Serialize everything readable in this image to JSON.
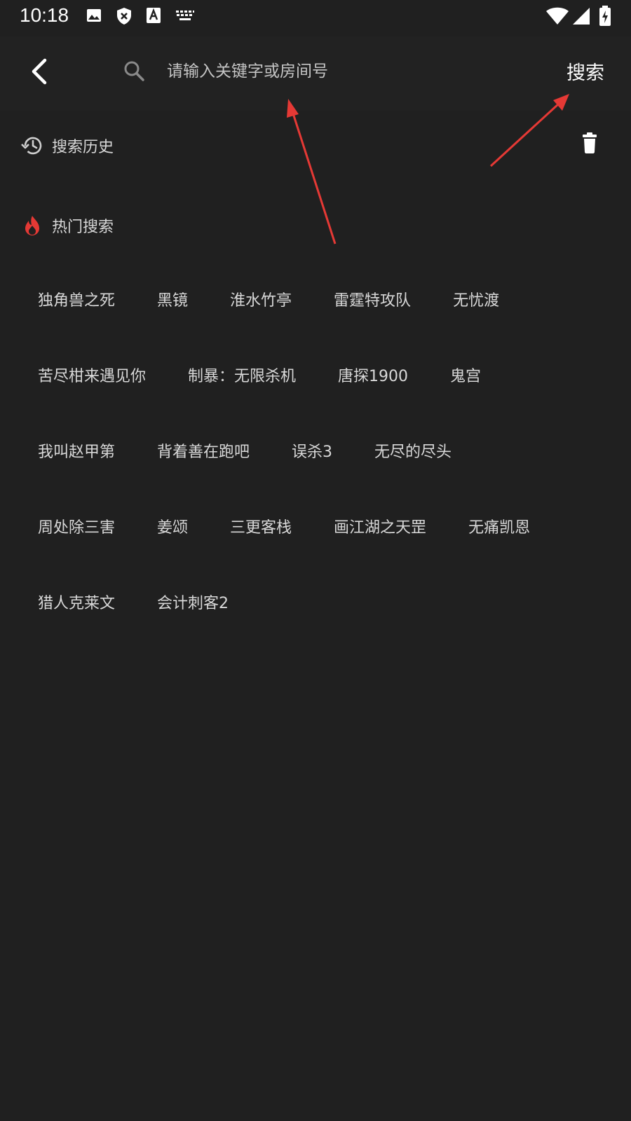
{
  "status_bar": {
    "time": "10:18",
    "icons": [
      "image-icon",
      "shield-icon",
      "text-a-icon",
      "keyboard-icon",
      "wifi-icon",
      "signal-icon",
      "battery-icon"
    ]
  },
  "search": {
    "placeholder": "请输入关键字或房间号",
    "value": "",
    "button_label": "搜索"
  },
  "history": {
    "title": "搜索历史"
  },
  "hot": {
    "title": "热门搜索",
    "rows": [
      [
        "独角兽之死",
        "黑镜",
        "淮水竹亭",
        "雷霆特攻队",
        "无忧渡"
      ],
      [
        "苦尽柑来遇见你",
        "制暴：无限杀机",
        "唐探1900",
        "鬼宫"
      ],
      [
        "我叫赵甲第",
        "背着善在跑吧",
        "误杀3",
        "无尽的尽头"
      ],
      [
        "周处除三害",
        "姜颂",
        "三更客栈",
        "画江湖之天罡",
        "无痛凯恩"
      ],
      [
        "猎人克莱文",
        "会计刺客2"
      ]
    ]
  },
  "colors": {
    "background": "#202020",
    "text": "#d8d8d8",
    "accent_red": "#e53935"
  }
}
